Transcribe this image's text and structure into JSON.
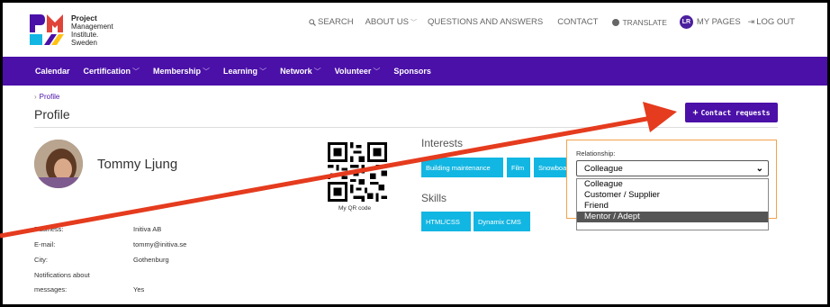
{
  "brand": {
    "name_line1": "Project",
    "name_line2": "Management",
    "name_line3": "Institute.",
    "name_line4": "Sweden",
    "colors": {
      "purple": "#4b10a8",
      "cyan": "#12b6e2",
      "orange": "#f3a24a",
      "arrow": "#e53b1e"
    }
  },
  "topnav": {
    "search": "SEARCH",
    "about": "ABOUT US",
    "qa": "QUESTIONS AND ANSWERS",
    "contact": "CONTACT",
    "translate": "TRANSLATE",
    "avatar_initials": "LR",
    "my_pages": "MY PAGES",
    "logout": "LOG OUT"
  },
  "mainnav": {
    "calendar": "Calendar",
    "certification": "Certification",
    "membership": "Membership",
    "learning": "Learning",
    "network": "Network",
    "volunteer": "Volunteer",
    "sponsors": "Sponsors"
  },
  "breadcrumb": {
    "current": "Profile"
  },
  "page": {
    "title": "Profile",
    "contact_requests": "Contact requests"
  },
  "profile": {
    "name": "Tommy Ljung",
    "qr_caption": "My QR code",
    "fields": {
      "business_label": "Business:",
      "business_value": "Initiva AB",
      "email_label": "E-mail:",
      "email_value": "tommy@initiva.se",
      "city_label": "City:",
      "city_value": "Gothenburg",
      "notif_label_1": "Notifications about",
      "notif_label_2": "messages:",
      "notif_value": "Yes"
    }
  },
  "interests": {
    "heading": "Interests",
    "tags": [
      "Building maintenance",
      "Film",
      "Snowboa"
    ]
  },
  "skills": {
    "heading": "Skills",
    "tags": [
      "HTML/CSS",
      "Dynamix CMS"
    ]
  },
  "relationship": {
    "label": "Relationship:",
    "selected": "Colleague",
    "options": [
      "Colleague",
      "Customer / Supplier",
      "Friend",
      "Mentor / Adept"
    ],
    "highlighted_index": 3
  }
}
